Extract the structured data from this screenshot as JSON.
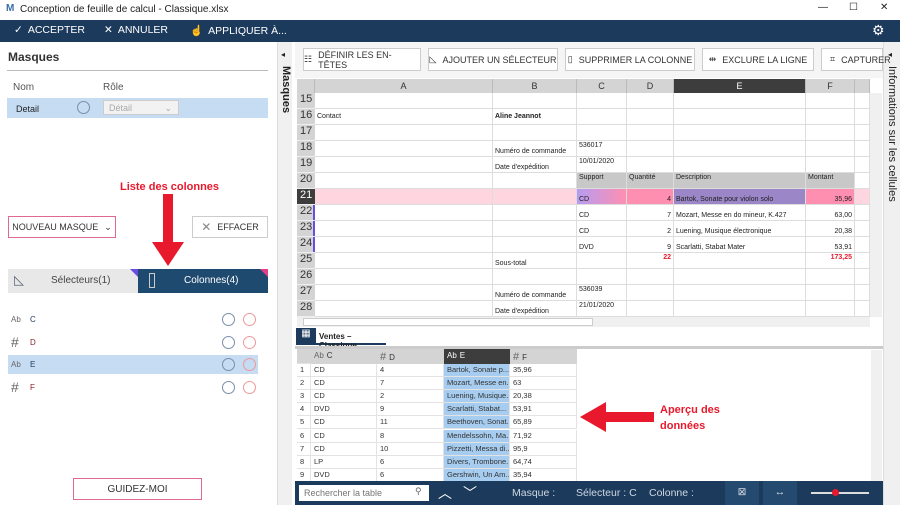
{
  "window": {
    "title": "Conception de feuille de calcul - Classique.xlsx"
  },
  "toolbar": {
    "accept": "ACCEPTER",
    "cancel": "ANNULER",
    "apply": "APPLIQUER À..."
  },
  "left": {
    "title": "Masques",
    "col_name": "Nom",
    "col_role": "Rôle",
    "mask_name": "Detail",
    "mask_role": "Détail",
    "new_mask": "NOUVEAU MASQUE",
    "clear": "EFFACER",
    "tab_selectors": "Sélecteurs(1)",
    "tab_columns": "Colonnes(4)",
    "columns": [
      {
        "type": "Ab",
        "name": "C"
      },
      {
        "type": "#",
        "name": "D"
      },
      {
        "type": "Ab",
        "name": "E",
        "selected": true
      },
      {
        "type": "#",
        "name": "F"
      }
    ],
    "guide": "GUIDEZ-MOI"
  },
  "annotations": {
    "columns_list": "Liste des colonnes",
    "preview": "Aperçu des données"
  },
  "strips": {
    "masks": "Masques",
    "cell_info": "Informations sur les cellules"
  },
  "sheet_toolbar": {
    "define_headers": "DÉFINIR LES EN-TÊTES",
    "add_selector": "AJOUTER UN SÉLECTEUR",
    "delete_column": "SUPPRIMER LA COLONNE",
    "exclude_row": "EXCLURE LA LIGNE",
    "capture": "CAPTURER"
  },
  "sheet": {
    "columns": [
      "A",
      "B",
      "C",
      "D",
      "E",
      "F"
    ],
    "selected_column": "E",
    "selected_row": "21",
    "rows": [
      {
        "n": "15",
        "cells": [
          "",
          "",
          "",
          "",
          "",
          ""
        ]
      },
      {
        "n": "16",
        "cells": [
          "Contact",
          "Aline Jeannot",
          "",
          "",
          "",
          ""
        ]
      },
      {
        "n": "17",
        "cells": [
          "",
          "",
          "",
          "",
          "",
          ""
        ]
      },
      {
        "n": "18",
        "cells": [
          "",
          "Numéro de commande",
          "536017",
          "",
          "",
          ""
        ]
      },
      {
        "n": "19",
        "cells": [
          "",
          "Date d'expédition",
          "10/01/2020",
          "",
          "",
          ""
        ]
      },
      {
        "n": "20",
        "cells": [
          "",
          "",
          "Support",
          "Quantité",
          "Description",
          "Montant"
        ]
      },
      {
        "n": "21",
        "cells": [
          "",
          "",
          "CD",
          "4",
          "Bartok, Sonate pour violon solo",
          "35,96"
        ]
      },
      {
        "n": "22",
        "cells": [
          "",
          "",
          "CD",
          "7",
          "Mozart, Messe en do mineur, K.427",
          "63,00"
        ]
      },
      {
        "n": "23",
        "cells": [
          "",
          "",
          "CD",
          "2",
          "Luening, Musique électronique",
          "20,38"
        ]
      },
      {
        "n": "24",
        "cells": [
          "",
          "",
          "DVD",
          "9",
          "Scarlatti, Stabat Mater",
          "53,91"
        ]
      },
      {
        "n": "25",
        "cells": [
          "",
          "Sous-total",
          "",
          "22",
          "",
          "173,25"
        ]
      },
      {
        "n": "26",
        "cells": [
          "",
          "",
          "",
          "",
          "",
          ""
        ]
      },
      {
        "n": "27",
        "cells": [
          "",
          "Numéro de commande",
          "536039",
          "",
          "",
          ""
        ]
      },
      {
        "n": "28",
        "cells": [
          "",
          "Date d'expédition",
          "21/01/2020",
          "",
          "",
          ""
        ]
      }
    ],
    "tab": "Ventes – Classique"
  },
  "preview": {
    "headers": [
      {
        "type": "Ab",
        "name": "C"
      },
      {
        "type": "#",
        "name": "D"
      },
      {
        "type": "Ab",
        "name": "E"
      },
      {
        "type": "#",
        "name": "F"
      }
    ],
    "rows": [
      [
        "1",
        "CD",
        "4",
        "Bartok, Sonate p...",
        "35,96"
      ],
      [
        "2",
        "CD",
        "7",
        "Mozart, Messe en...",
        "63"
      ],
      [
        "3",
        "CD",
        "2",
        "Luening, Musique...",
        "20,38"
      ],
      [
        "4",
        "DVD",
        "9",
        "Scarlatti, Stabat...",
        "53,91"
      ],
      [
        "5",
        "CD",
        "11",
        "Beethoven, Sonat...",
        "65,89"
      ],
      [
        "6",
        "CD",
        "8",
        "Mendelssohn, Ma...",
        "71,92"
      ],
      [
        "7",
        "CD",
        "10",
        "Pizzetti, Messa di...",
        "95,9"
      ],
      [
        "8",
        "LP",
        "6",
        "Divers, Trombone...",
        "64,74"
      ],
      [
        "9",
        "DVD",
        "6",
        "Gershwin, Un Am...",
        "35,94"
      ]
    ]
  },
  "statusbar": {
    "search_placeholder": "Rechercher la table",
    "mask_label": "Masque :",
    "selector_label": "Sélecteur : C",
    "column_label": "Colonne :"
  },
  "colors": {
    "navy": "#1c3a5c",
    "accent_red": "#e8192c",
    "highlight_pink": "#ff8fb1",
    "purple": "#9b86c8",
    "selection_blue": "#c5dcf3"
  }
}
